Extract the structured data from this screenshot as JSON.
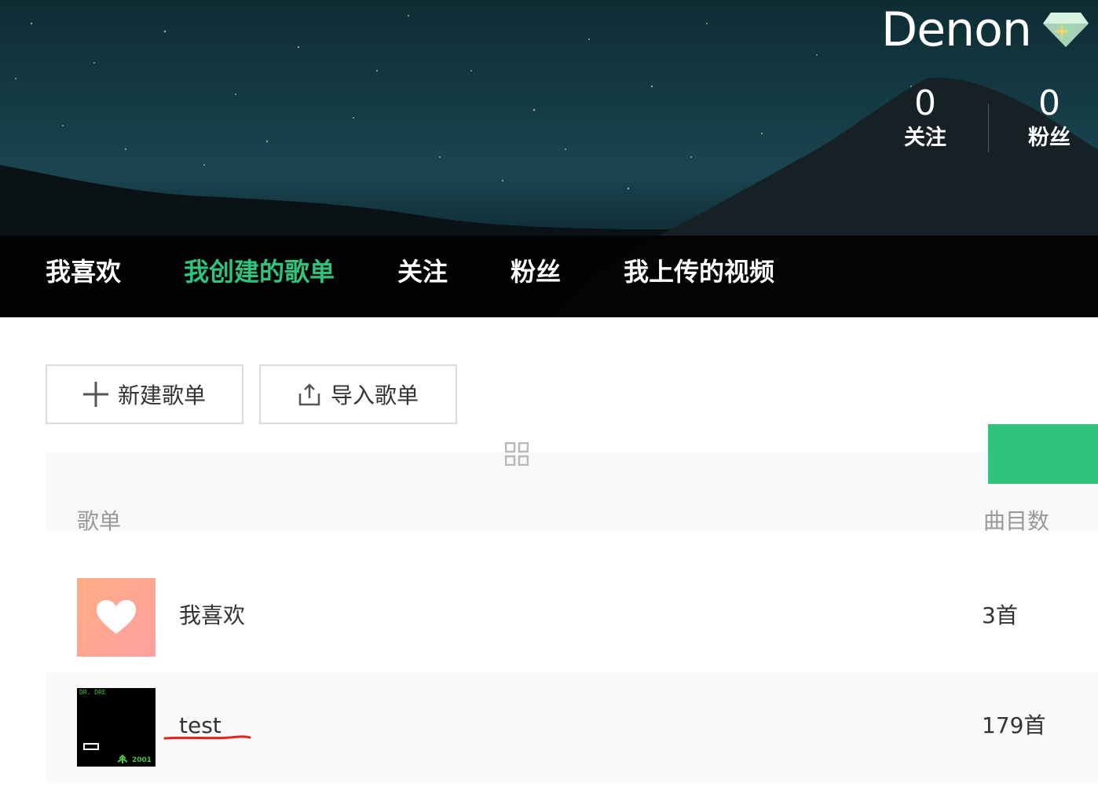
{
  "profile": {
    "username": "Denon",
    "stats": [
      {
        "value": "0",
        "label": "关注"
      },
      {
        "value": "0",
        "label": "粉丝"
      }
    ]
  },
  "nav": {
    "items": [
      {
        "label": "我喜欢",
        "active": false
      },
      {
        "label": "我创建的歌单",
        "active": true
      },
      {
        "label": "关注",
        "active": false
      },
      {
        "label": "粉丝",
        "active": false
      },
      {
        "label": "我上传的视频",
        "active": false
      }
    ]
  },
  "toolbar": {
    "new_playlist": "新建歌单",
    "import_playlist": "导入歌单"
  },
  "table": {
    "headers": {
      "name": "歌单",
      "count": "曲目数"
    },
    "rows": [
      {
        "name": "我喜欢",
        "count": "3首",
        "cover": "heart-icon"
      },
      {
        "name": "test",
        "count": "179首",
        "cover": "album-cover",
        "cover_text_top": "DR. DRE",
        "cover_text_bottom": "2001"
      }
    ]
  },
  "colors": {
    "accent": "#31c27c",
    "underline": "#e8221b"
  }
}
